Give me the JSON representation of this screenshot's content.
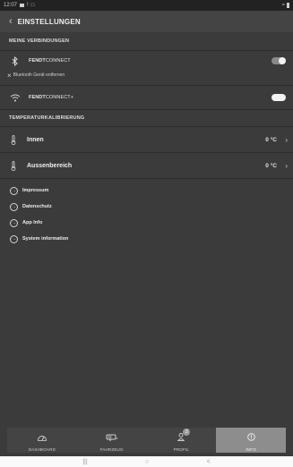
{
  "status_bar": {
    "time": "12:07"
  },
  "header": {
    "back_icon": "chevron-left",
    "title": "EINSTELLUNGEN"
  },
  "connections": {
    "section_title": "MEINE VERBINDUNGEN",
    "items": [
      {
        "icon": "bluetooth-icon",
        "brand": "FENDT",
        "suffix": "CONNECT",
        "toggle_on": true
      },
      {
        "icon": "wifi-icon",
        "brand": "FENDT",
        "suffix": "CONNECT+",
        "toggle_on": false
      }
    ],
    "remove_label": "Bluetooth Gerät entfernen"
  },
  "temperature": {
    "section_title": "TEMPERATURKALIBRIERUNG",
    "items": [
      {
        "label": "Innen",
        "value": "0 °C"
      },
      {
        "label": "Aussenbereich",
        "value": "0 °C"
      }
    ]
  },
  "links": [
    "Impressum",
    "Datenschutz",
    "App Info",
    "System information"
  ],
  "bottom_nav": {
    "items": [
      {
        "label": "DASHBOARD",
        "icon": "speedometer-icon"
      },
      {
        "label": "FAHRZEUG",
        "icon": "caravan-icon"
      },
      {
        "label": "PROFIL",
        "icon": "user-icon",
        "badge": "2"
      },
      {
        "label": "INFO",
        "icon": "info-icon",
        "active": true
      }
    ]
  },
  "system_nav": {
    "recents": "|||",
    "home": "○",
    "back": "<"
  }
}
